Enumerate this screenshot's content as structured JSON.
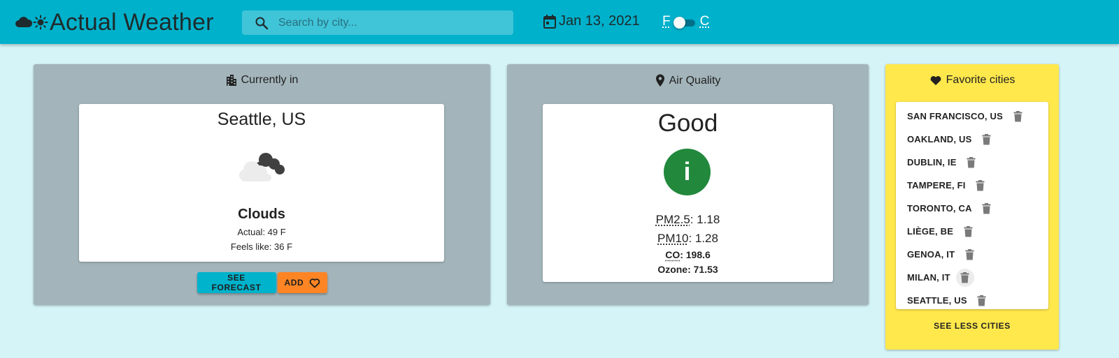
{
  "header": {
    "title": "Actual Weather",
    "search_placeholder": "Search by city...",
    "date": "Jan 13, 2021",
    "unit_left": "F",
    "unit_right": "C",
    "accent": "#00b1cb"
  },
  "current": {
    "heading": "Currently in",
    "city": "Seattle, US",
    "condition": "Clouds",
    "actual": "Actual: 49 F",
    "feels_like": "Feels like: 36 F",
    "see_forecast_label": "SEE FORECAST",
    "add_label": "ADD"
  },
  "air_quality": {
    "heading": "Air Quality",
    "rating": "Good",
    "rating_icon": "info",
    "rating_color": "#21883c",
    "pm25_label": "PM2.5",
    "pm25_value": ": 1.18",
    "pm10_label": "PM10",
    "pm10_value": ": 1.28",
    "co_label": "CO",
    "co_value": ": 198.6",
    "ozone": "Ozone: 71.53"
  },
  "favorites": {
    "heading": "Favorite cities",
    "cities": [
      "SAN FRANCISCO, US",
      "OAKLAND, US",
      "DUBLIN, IE",
      "TAMPERE, FI",
      "TORONTO, CA",
      "LIÈGE, BE",
      "GENOA, IT",
      "MILAN, IT",
      "SEATTLE, US"
    ],
    "see_less_label": "SEE LESS CITIES",
    "panel_color": "#ffe84c"
  }
}
